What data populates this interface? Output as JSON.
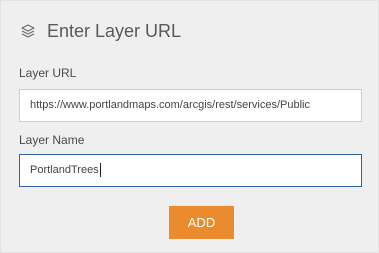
{
  "dialog": {
    "title": "Enter Layer URL",
    "title_icon": "layers-icon"
  },
  "layer_url": {
    "label": "Layer URL",
    "value": "https://www.portlandmaps.com/arcgis/rest/services/Public"
  },
  "layer_name": {
    "label": "Layer Name",
    "value": "PortlandTrees"
  },
  "actions": {
    "add_label": "ADD"
  },
  "colors": {
    "panel_background": "#efefef",
    "button_accent": "#ea8c2e",
    "focus_border": "#2f63a4"
  }
}
